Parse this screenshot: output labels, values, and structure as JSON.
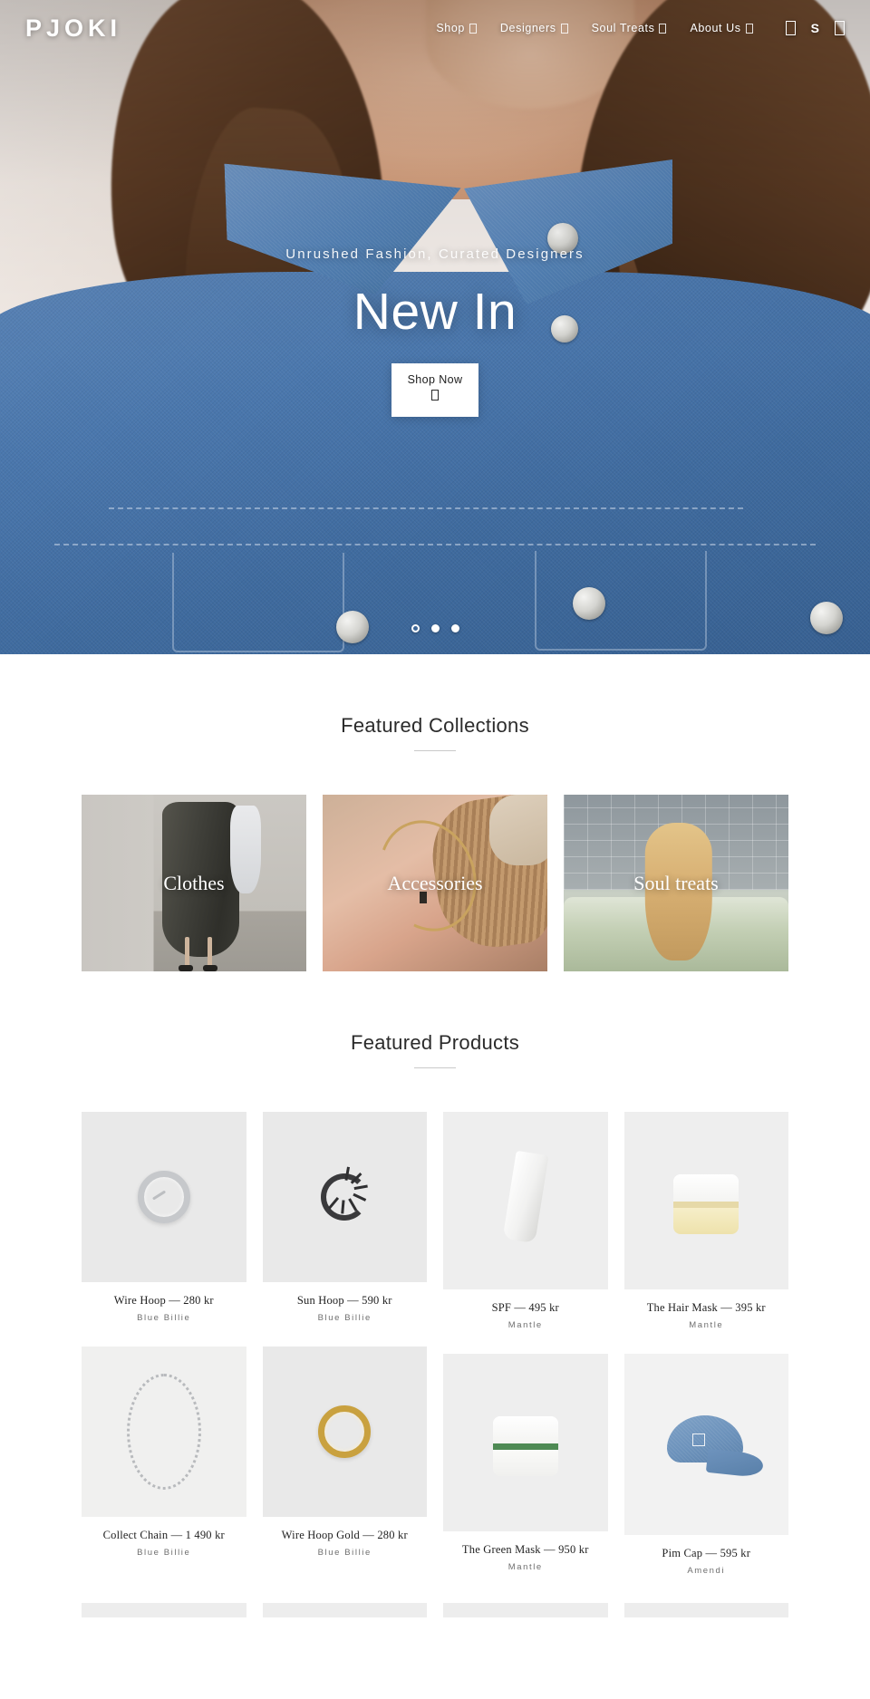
{
  "header": {
    "logo": "PJOKI",
    "nav": [
      {
        "label": "Shop",
        "has_caret": true
      },
      {
        "label": "Designers",
        "has_caret": true
      },
      {
        "label": "Soul Treats",
        "has_caret": true
      },
      {
        "label": "About Us",
        "has_caret": true
      }
    ],
    "icons": {
      "search": "search-icon",
      "currency": "S",
      "cart": "cart-icon"
    }
  },
  "hero": {
    "tagline": "Unrushed Fashion, Curated Designers",
    "title": "New In",
    "button_label": "Shop Now",
    "button_icon": "arrow-right-icon",
    "slides": 3,
    "active_slide": 1
  },
  "collections_section": {
    "title": "Featured Collections",
    "items": [
      {
        "label": "Clothes"
      },
      {
        "label": "Accessories"
      },
      {
        "label": "Soul treats"
      }
    ]
  },
  "products_section": {
    "title": "Featured Products",
    "items": [
      {
        "title": "Wire Hoop — 280 kr",
        "brand": "Blue Billie"
      },
      {
        "title": "Collect Chain — 1 490 kr",
        "brand": "Blue Billie"
      },
      {
        "title": "Sun Hoop — 590 kr",
        "brand": "Blue Billie"
      },
      {
        "title": "Wire Hoop Gold — 280 kr",
        "brand": "Blue Billie"
      },
      {
        "title": "SPF — 495 kr",
        "brand": "Mantle"
      },
      {
        "title": "The Green Mask — 950 kr",
        "brand": "Mantle"
      },
      {
        "title": "The Hair Mask — 395 kr",
        "brand": "Mantle"
      },
      {
        "title": "Pim Cap — 595 kr",
        "brand": "Amendi"
      }
    ]
  },
  "colors": {
    "denim": "#4a77ad",
    "text": "#1c1c1c",
    "muted": "#6f6f6f",
    "rule": "#c9c9c9"
  }
}
